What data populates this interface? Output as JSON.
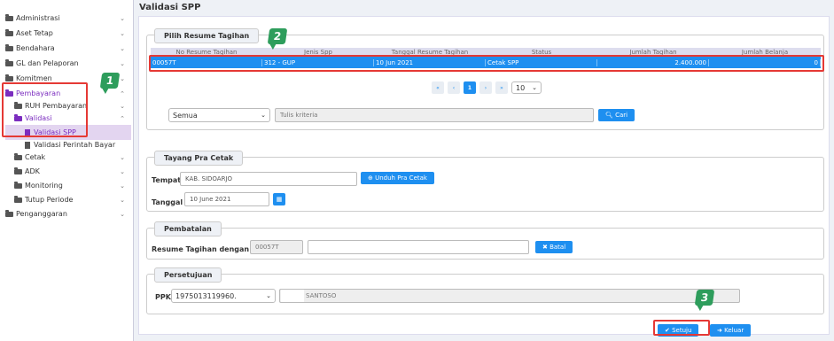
{
  "sidebar": {
    "items": [
      {
        "label": "Administrasi",
        "chev": "⌄"
      },
      {
        "label": "Aset Tetap",
        "chev": "⌄"
      },
      {
        "label": "Bendahara",
        "chev": "⌄"
      },
      {
        "label": "GL dan Pelaporan",
        "chev": "⌄"
      },
      {
        "label": "Komitmen",
        "chev": "⌄"
      },
      {
        "label": "Pembayaran",
        "chev": "⌃"
      },
      {
        "label": "RUH Pembayaran",
        "chev": "⌄"
      },
      {
        "label": "Validasi",
        "chev": "⌃"
      },
      {
        "label": "Validasi SPP"
      },
      {
        "label": "Validasi Perintah Bayar"
      },
      {
        "label": "Cetak",
        "chev": "⌄"
      },
      {
        "label": "ADK",
        "chev": "⌄"
      },
      {
        "label": "Monitoring",
        "chev": "⌄"
      },
      {
        "label": "Tutup Periode",
        "chev": "⌄"
      },
      {
        "label": "Penganggaran",
        "chev": "⌄"
      }
    ]
  },
  "page": {
    "title": "Validasi SPP"
  },
  "resume": {
    "legend": "Pilih Resume Tagihan",
    "columns": [
      "No Resume Tagihan",
      "Jenis Spp",
      "Tanggal Resume Tagihan",
      "Status",
      "Jumlah Tagihan",
      "Jumlah Belanja"
    ],
    "selected_row": [
      "00057T",
      "312 - GUP",
      "10 Jun 2021",
      "Cetak SPP",
      "2.400.000",
      "0"
    ],
    "pager": {
      "first": "«",
      "prev": "‹",
      "page": "1",
      "next": "›",
      "last": "»",
      "page_size": "10"
    },
    "filter_value": "Semua",
    "search_placeholder": "Tulis kriteria",
    "search_button": "Cari"
  },
  "tayang": {
    "legend": "Tayang Pra Cetak",
    "tempat_label": "Tempat",
    "tempat_value": "KAB. SIDOARJO",
    "unduh_button": "Unduh Pra Cetak",
    "tanggal_label": "Tanggal",
    "tanggal_value": "10 June 2021"
  },
  "pembatalan": {
    "legend": "Pembatalan",
    "label": "Resume Tagihan dengan No",
    "no_value": "00057T",
    "batal_button": "Batal"
  },
  "persetujuan": {
    "legend": "Persetujuan",
    "ppk_label": "PPK",
    "ppk_value": "1975013119960.",
    "ppk_name": "SANTOSO"
  },
  "actions": {
    "setuju": "Setuju",
    "keluar": "Keluar"
  },
  "markers": {
    "m1": "1",
    "m2": "2",
    "m3": "3"
  },
  "colors": {
    "accent": "#1e8ff0",
    "active_menu": "#7b2cbf",
    "highlight": "#e53935",
    "marker": "#2e9d5c"
  }
}
